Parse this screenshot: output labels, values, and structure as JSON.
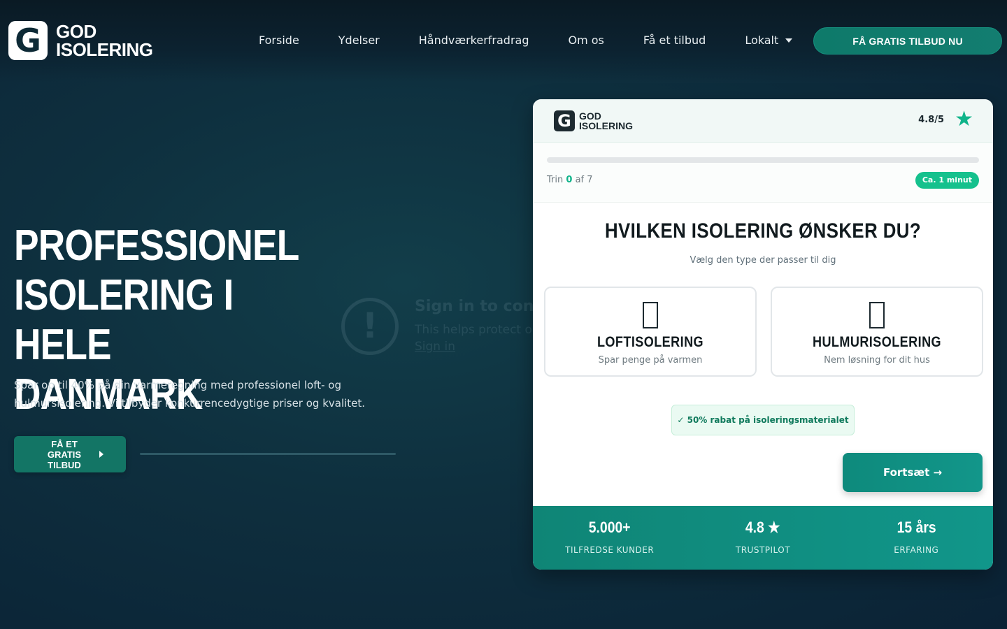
{
  "nav": {
    "logo_letter": "G",
    "logo_line1": "GOD",
    "logo_line2": "ISOLERING",
    "links": [
      "Forside",
      "Ydelser",
      "Håndværkerfradrag",
      "Om os",
      "Få et tilbud",
      "Lokalt"
    ],
    "cta": "FÅ GRATIS TILBUD NU"
  },
  "hero": {
    "title_line1": "PROFESSIONEL",
    "title_line2": "ISOLERING I HELE",
    "title_line3": "DANMARK",
    "subtitle": "Spar op til 40% på din varmeregning med professionel loft- og hulmursisolering. Vi tilbyder konkurrencedygtige priser og kvalitet.",
    "button_line1": "FÅ ET GRATIS",
    "button_line2": "TILBUD"
  },
  "overlay": {
    "icon": "!",
    "title": "Sign in to confirm",
    "text": "This helps protect ou",
    "link": "Sign in"
  },
  "card": {
    "logo_letter": "G",
    "logo_line1": "GOD",
    "logo_line2": "ISOLERING",
    "rating": "4.8/5",
    "star": "★",
    "progress": 0,
    "step_prefix": "Trin",
    "step_current": "0",
    "step_suffix": "af 7",
    "time_pill": "Ca. 1 minut",
    "question": "HVILKEN ISOLERING ØNSKER DU?",
    "question_sub": "Vælg den type der passer til dig",
    "options": [
      {
        "label": "LOFTISOLERING",
        "desc": "Spar penge på varmen",
        "icon": "roof-icon"
      },
      {
        "label": "HULMURISOLERING",
        "desc": "Nem løsning for dit hus",
        "icon": "wall-icon"
      }
    ],
    "discount": "✓ 50% rabat på isoleringsmaterialet",
    "continue": "Fortsæt →",
    "stats": [
      {
        "value": "5.000+",
        "label": "TILFREDSE KUNDER"
      },
      {
        "value": "4.8 ★",
        "label": "TRUSTPILOT"
      },
      {
        "value": "15 års",
        "label": "ERFARING"
      }
    ]
  },
  "colors": {
    "accent": "#10b48a",
    "teal": "#11968a",
    "background": "#0e2f3e"
  }
}
